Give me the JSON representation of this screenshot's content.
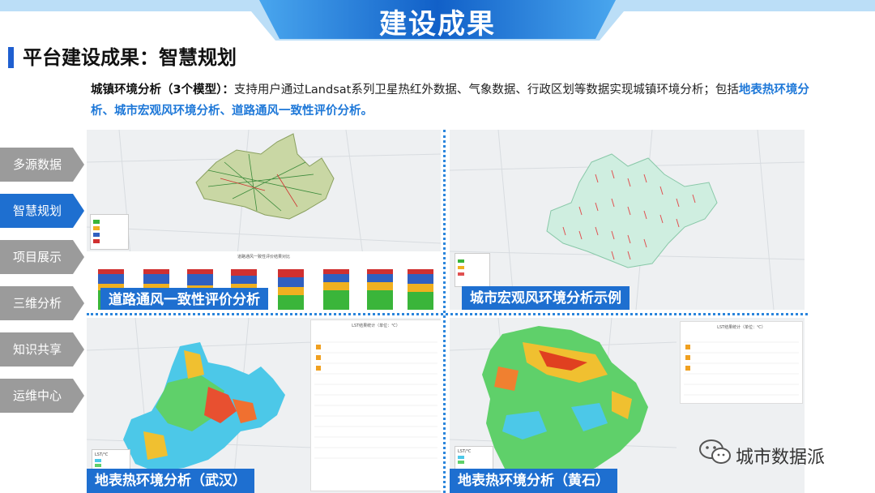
{
  "header": {
    "title": "建设成果",
    "color_dark": "#1160c8",
    "color_light": "#49a6ee"
  },
  "section": {
    "title": "平台建设成果：智慧规划"
  },
  "description": {
    "lead": "城镇环境分析（3个模型）：",
    "body": "支持用户通过Landsat系列卫星热红外数据、气象数据、行政区划等数据实现城镇环境分析；包括",
    "highlight": "地表热环境分析、城市宏观风环境分析、道路通风一致性评价分析。"
  },
  "nav": {
    "items": [
      {
        "label": "多源数据",
        "active": false
      },
      {
        "label": "智慧规划",
        "active": true
      },
      {
        "label": "项目展示",
        "active": false
      },
      {
        "label": "三维分析",
        "active": false
      },
      {
        "label": "知识共享",
        "active": false
      },
      {
        "label": "运维中心",
        "active": false
      }
    ],
    "color_inactive": "#9b9b9b",
    "color_active": "#1e6fd0"
  },
  "panels": {
    "road": {
      "caption": "道路通风一致性评价分析",
      "chart_title": "道路通风一致性评价结果对比"
    },
    "wind": {
      "caption": "城市宏观风环境分析示例"
    },
    "wuhan": {
      "caption": "地表热环境分析（武汉）",
      "table_title": "LST结果统计（单位：℃）",
      "legend_title": "LST/℃"
    },
    "huangshi": {
      "caption": "地表热环境分析（黄石）",
      "table_title": "LST结果统计（单位：℃）",
      "legend_title": "LST/℃"
    }
  },
  "watermark": {
    "text": "城市数据派"
  }
}
